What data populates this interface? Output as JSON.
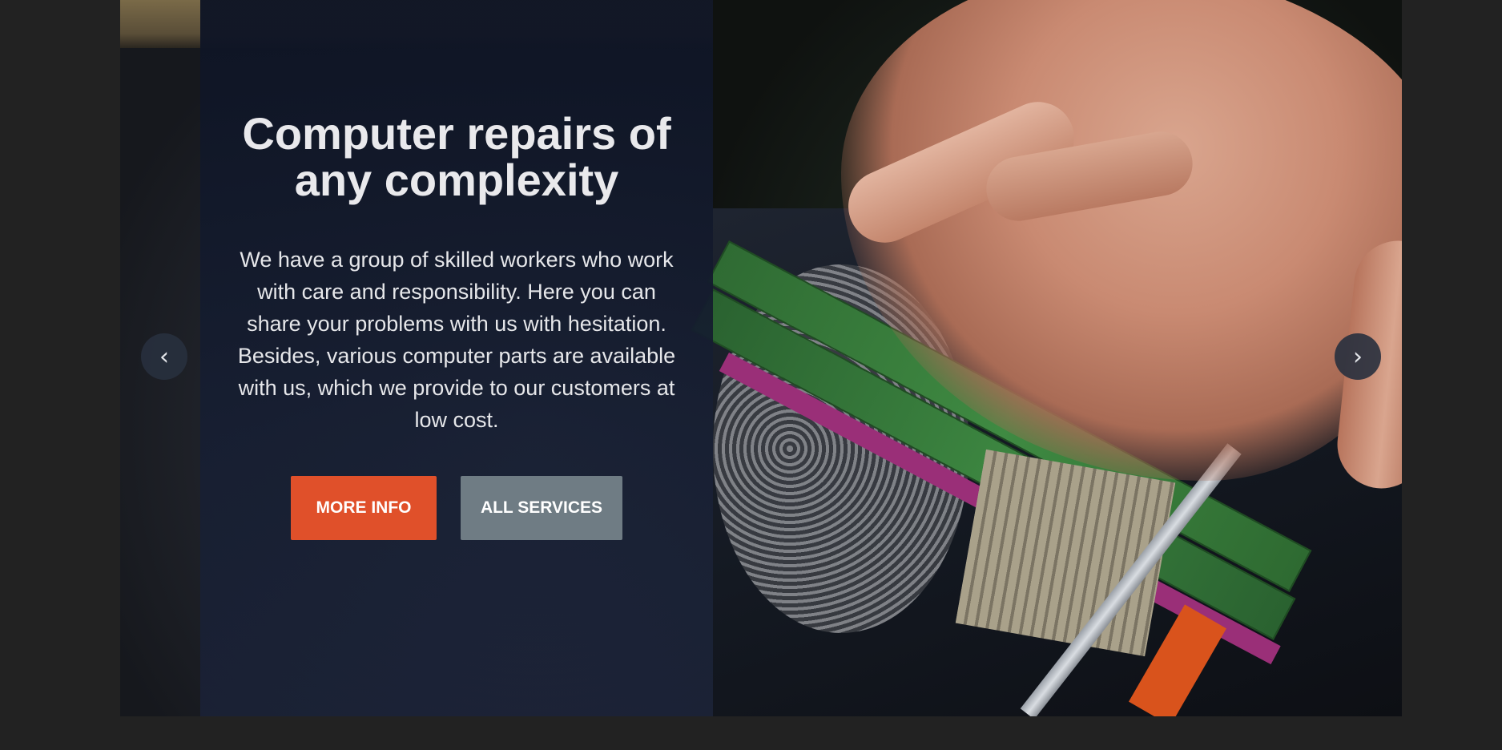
{
  "hero": {
    "title": "Computer repairs of any complexity",
    "description": "We have a group of skilled workers who work with care and responsibility. Here you can share your problems with us with hesitation. Besides, various computer parts are available with us, which we provide to our customers at low cost.",
    "buttons": {
      "more_info": "MORE INFO",
      "all_services": "ALL SERVICES"
    }
  },
  "slider": {
    "prev_icon": "‹",
    "next_icon": "›"
  },
  "colors": {
    "page_background": "#222222",
    "panel_background": "#0e1424",
    "accent": "#e0502a",
    "secondary_button": "#6f7c84"
  }
}
